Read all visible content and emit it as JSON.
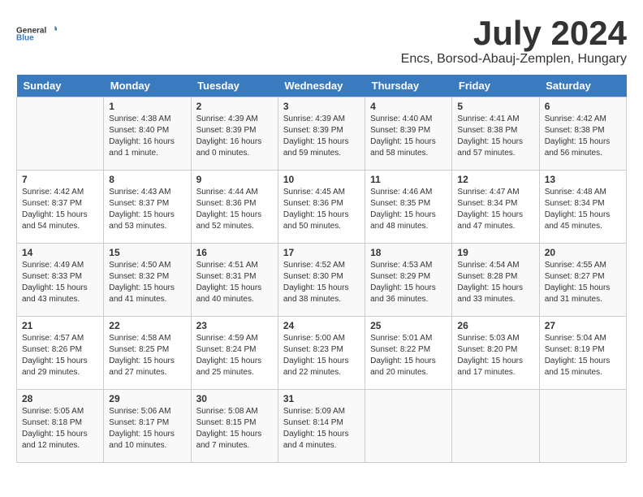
{
  "logo": {
    "line1": "General",
    "line2": "Blue"
  },
  "title": "July 2024",
  "location": "Encs, Borsod-Abauj-Zemplen, Hungary",
  "days_of_week": [
    "Sunday",
    "Monday",
    "Tuesday",
    "Wednesday",
    "Thursday",
    "Friday",
    "Saturday"
  ],
  "weeks": [
    [
      {
        "day": "",
        "sunrise": "",
        "sunset": "",
        "daylight": ""
      },
      {
        "day": "1",
        "sunrise": "Sunrise: 4:38 AM",
        "sunset": "Sunset: 8:40 PM",
        "daylight": "Daylight: 16 hours and 1 minute."
      },
      {
        "day": "2",
        "sunrise": "Sunrise: 4:39 AM",
        "sunset": "Sunset: 8:39 PM",
        "daylight": "Daylight: 16 hours and 0 minutes."
      },
      {
        "day": "3",
        "sunrise": "Sunrise: 4:39 AM",
        "sunset": "Sunset: 8:39 PM",
        "daylight": "Daylight: 15 hours and 59 minutes."
      },
      {
        "day": "4",
        "sunrise": "Sunrise: 4:40 AM",
        "sunset": "Sunset: 8:39 PM",
        "daylight": "Daylight: 15 hours and 58 minutes."
      },
      {
        "day": "5",
        "sunrise": "Sunrise: 4:41 AM",
        "sunset": "Sunset: 8:38 PM",
        "daylight": "Daylight: 15 hours and 57 minutes."
      },
      {
        "day": "6",
        "sunrise": "Sunrise: 4:42 AM",
        "sunset": "Sunset: 8:38 PM",
        "daylight": "Daylight: 15 hours and 56 minutes."
      }
    ],
    [
      {
        "day": "7",
        "sunrise": "Sunrise: 4:42 AM",
        "sunset": "Sunset: 8:37 PM",
        "daylight": "Daylight: 15 hours and 54 minutes."
      },
      {
        "day": "8",
        "sunrise": "Sunrise: 4:43 AM",
        "sunset": "Sunset: 8:37 PM",
        "daylight": "Daylight: 15 hours and 53 minutes."
      },
      {
        "day": "9",
        "sunrise": "Sunrise: 4:44 AM",
        "sunset": "Sunset: 8:36 PM",
        "daylight": "Daylight: 15 hours and 52 minutes."
      },
      {
        "day": "10",
        "sunrise": "Sunrise: 4:45 AM",
        "sunset": "Sunset: 8:36 PM",
        "daylight": "Daylight: 15 hours and 50 minutes."
      },
      {
        "day": "11",
        "sunrise": "Sunrise: 4:46 AM",
        "sunset": "Sunset: 8:35 PM",
        "daylight": "Daylight: 15 hours and 48 minutes."
      },
      {
        "day": "12",
        "sunrise": "Sunrise: 4:47 AM",
        "sunset": "Sunset: 8:34 PM",
        "daylight": "Daylight: 15 hours and 47 minutes."
      },
      {
        "day": "13",
        "sunrise": "Sunrise: 4:48 AM",
        "sunset": "Sunset: 8:34 PM",
        "daylight": "Daylight: 15 hours and 45 minutes."
      }
    ],
    [
      {
        "day": "14",
        "sunrise": "Sunrise: 4:49 AM",
        "sunset": "Sunset: 8:33 PM",
        "daylight": "Daylight: 15 hours and 43 minutes."
      },
      {
        "day": "15",
        "sunrise": "Sunrise: 4:50 AM",
        "sunset": "Sunset: 8:32 PM",
        "daylight": "Daylight: 15 hours and 41 minutes."
      },
      {
        "day": "16",
        "sunrise": "Sunrise: 4:51 AM",
        "sunset": "Sunset: 8:31 PM",
        "daylight": "Daylight: 15 hours and 40 minutes."
      },
      {
        "day": "17",
        "sunrise": "Sunrise: 4:52 AM",
        "sunset": "Sunset: 8:30 PM",
        "daylight": "Daylight: 15 hours and 38 minutes."
      },
      {
        "day": "18",
        "sunrise": "Sunrise: 4:53 AM",
        "sunset": "Sunset: 8:29 PM",
        "daylight": "Daylight: 15 hours and 36 minutes."
      },
      {
        "day": "19",
        "sunrise": "Sunrise: 4:54 AM",
        "sunset": "Sunset: 8:28 PM",
        "daylight": "Daylight: 15 hours and 33 minutes."
      },
      {
        "day": "20",
        "sunrise": "Sunrise: 4:55 AM",
        "sunset": "Sunset: 8:27 PM",
        "daylight": "Daylight: 15 hours and 31 minutes."
      }
    ],
    [
      {
        "day": "21",
        "sunrise": "Sunrise: 4:57 AM",
        "sunset": "Sunset: 8:26 PM",
        "daylight": "Daylight: 15 hours and 29 minutes."
      },
      {
        "day": "22",
        "sunrise": "Sunrise: 4:58 AM",
        "sunset": "Sunset: 8:25 PM",
        "daylight": "Daylight: 15 hours and 27 minutes."
      },
      {
        "day": "23",
        "sunrise": "Sunrise: 4:59 AM",
        "sunset": "Sunset: 8:24 PM",
        "daylight": "Daylight: 15 hours and 25 minutes."
      },
      {
        "day": "24",
        "sunrise": "Sunrise: 5:00 AM",
        "sunset": "Sunset: 8:23 PM",
        "daylight": "Daylight: 15 hours and 22 minutes."
      },
      {
        "day": "25",
        "sunrise": "Sunrise: 5:01 AM",
        "sunset": "Sunset: 8:22 PM",
        "daylight": "Daylight: 15 hours and 20 minutes."
      },
      {
        "day": "26",
        "sunrise": "Sunrise: 5:03 AM",
        "sunset": "Sunset: 8:20 PM",
        "daylight": "Daylight: 15 hours and 17 minutes."
      },
      {
        "day": "27",
        "sunrise": "Sunrise: 5:04 AM",
        "sunset": "Sunset: 8:19 PM",
        "daylight": "Daylight: 15 hours and 15 minutes."
      }
    ],
    [
      {
        "day": "28",
        "sunrise": "Sunrise: 5:05 AM",
        "sunset": "Sunset: 8:18 PM",
        "daylight": "Daylight: 15 hours and 12 minutes."
      },
      {
        "day": "29",
        "sunrise": "Sunrise: 5:06 AM",
        "sunset": "Sunset: 8:17 PM",
        "daylight": "Daylight: 15 hours and 10 minutes."
      },
      {
        "day": "30",
        "sunrise": "Sunrise: 5:08 AM",
        "sunset": "Sunset: 8:15 PM",
        "daylight": "Daylight: 15 hours and 7 minutes."
      },
      {
        "day": "31",
        "sunrise": "Sunrise: 5:09 AM",
        "sunset": "Sunset: 8:14 PM",
        "daylight": "Daylight: 15 hours and 4 minutes."
      },
      {
        "day": "",
        "sunrise": "",
        "sunset": "",
        "daylight": ""
      },
      {
        "day": "",
        "sunrise": "",
        "sunset": "",
        "daylight": ""
      },
      {
        "day": "",
        "sunrise": "",
        "sunset": "",
        "daylight": ""
      }
    ]
  ]
}
